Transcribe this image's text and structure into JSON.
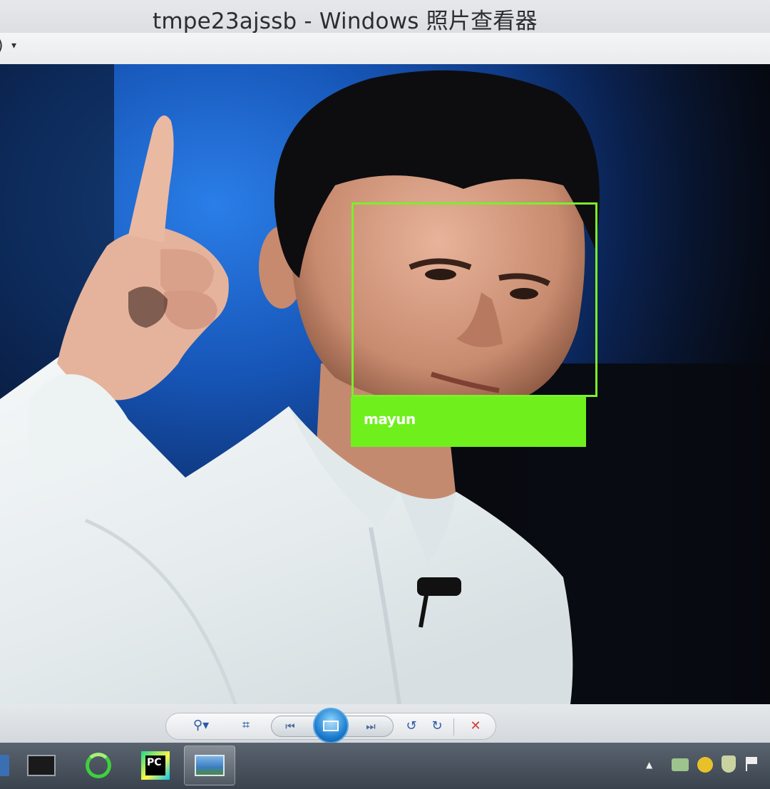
{
  "window": {
    "title": "tmpe23ajssb - Windows 照片查看器"
  },
  "menubar": {
    "visible_fragment": ")",
    "caret": "▾"
  },
  "face_detection": {
    "label": "mayun",
    "box_color": "#7bef2c"
  },
  "controls": {
    "zoom_icon": "zoom-icon",
    "fit_icon": "actual-size-icon",
    "previous_icon": "previous-icon",
    "slideshow_icon": "slideshow-icon",
    "next_icon": "next-icon",
    "rotate_ccw_icon": "rotate-counterclockwise-icon",
    "rotate_cw_icon": "rotate-clockwise-icon",
    "delete_icon": "delete-icon",
    "zoom_glyph": "⚲▾",
    "fit_glyph": "⌗",
    "previous_glyph": "⏮",
    "next_glyph": "⏭",
    "rotate_ccw_glyph": "↺",
    "rotate_cw_glyph": "↻",
    "delete_glyph": "✕",
    "delete_color": "#d43a3a"
  },
  "taskbar": {
    "pycharm_text": "PC",
    "tray_up_glyph": "▲"
  }
}
